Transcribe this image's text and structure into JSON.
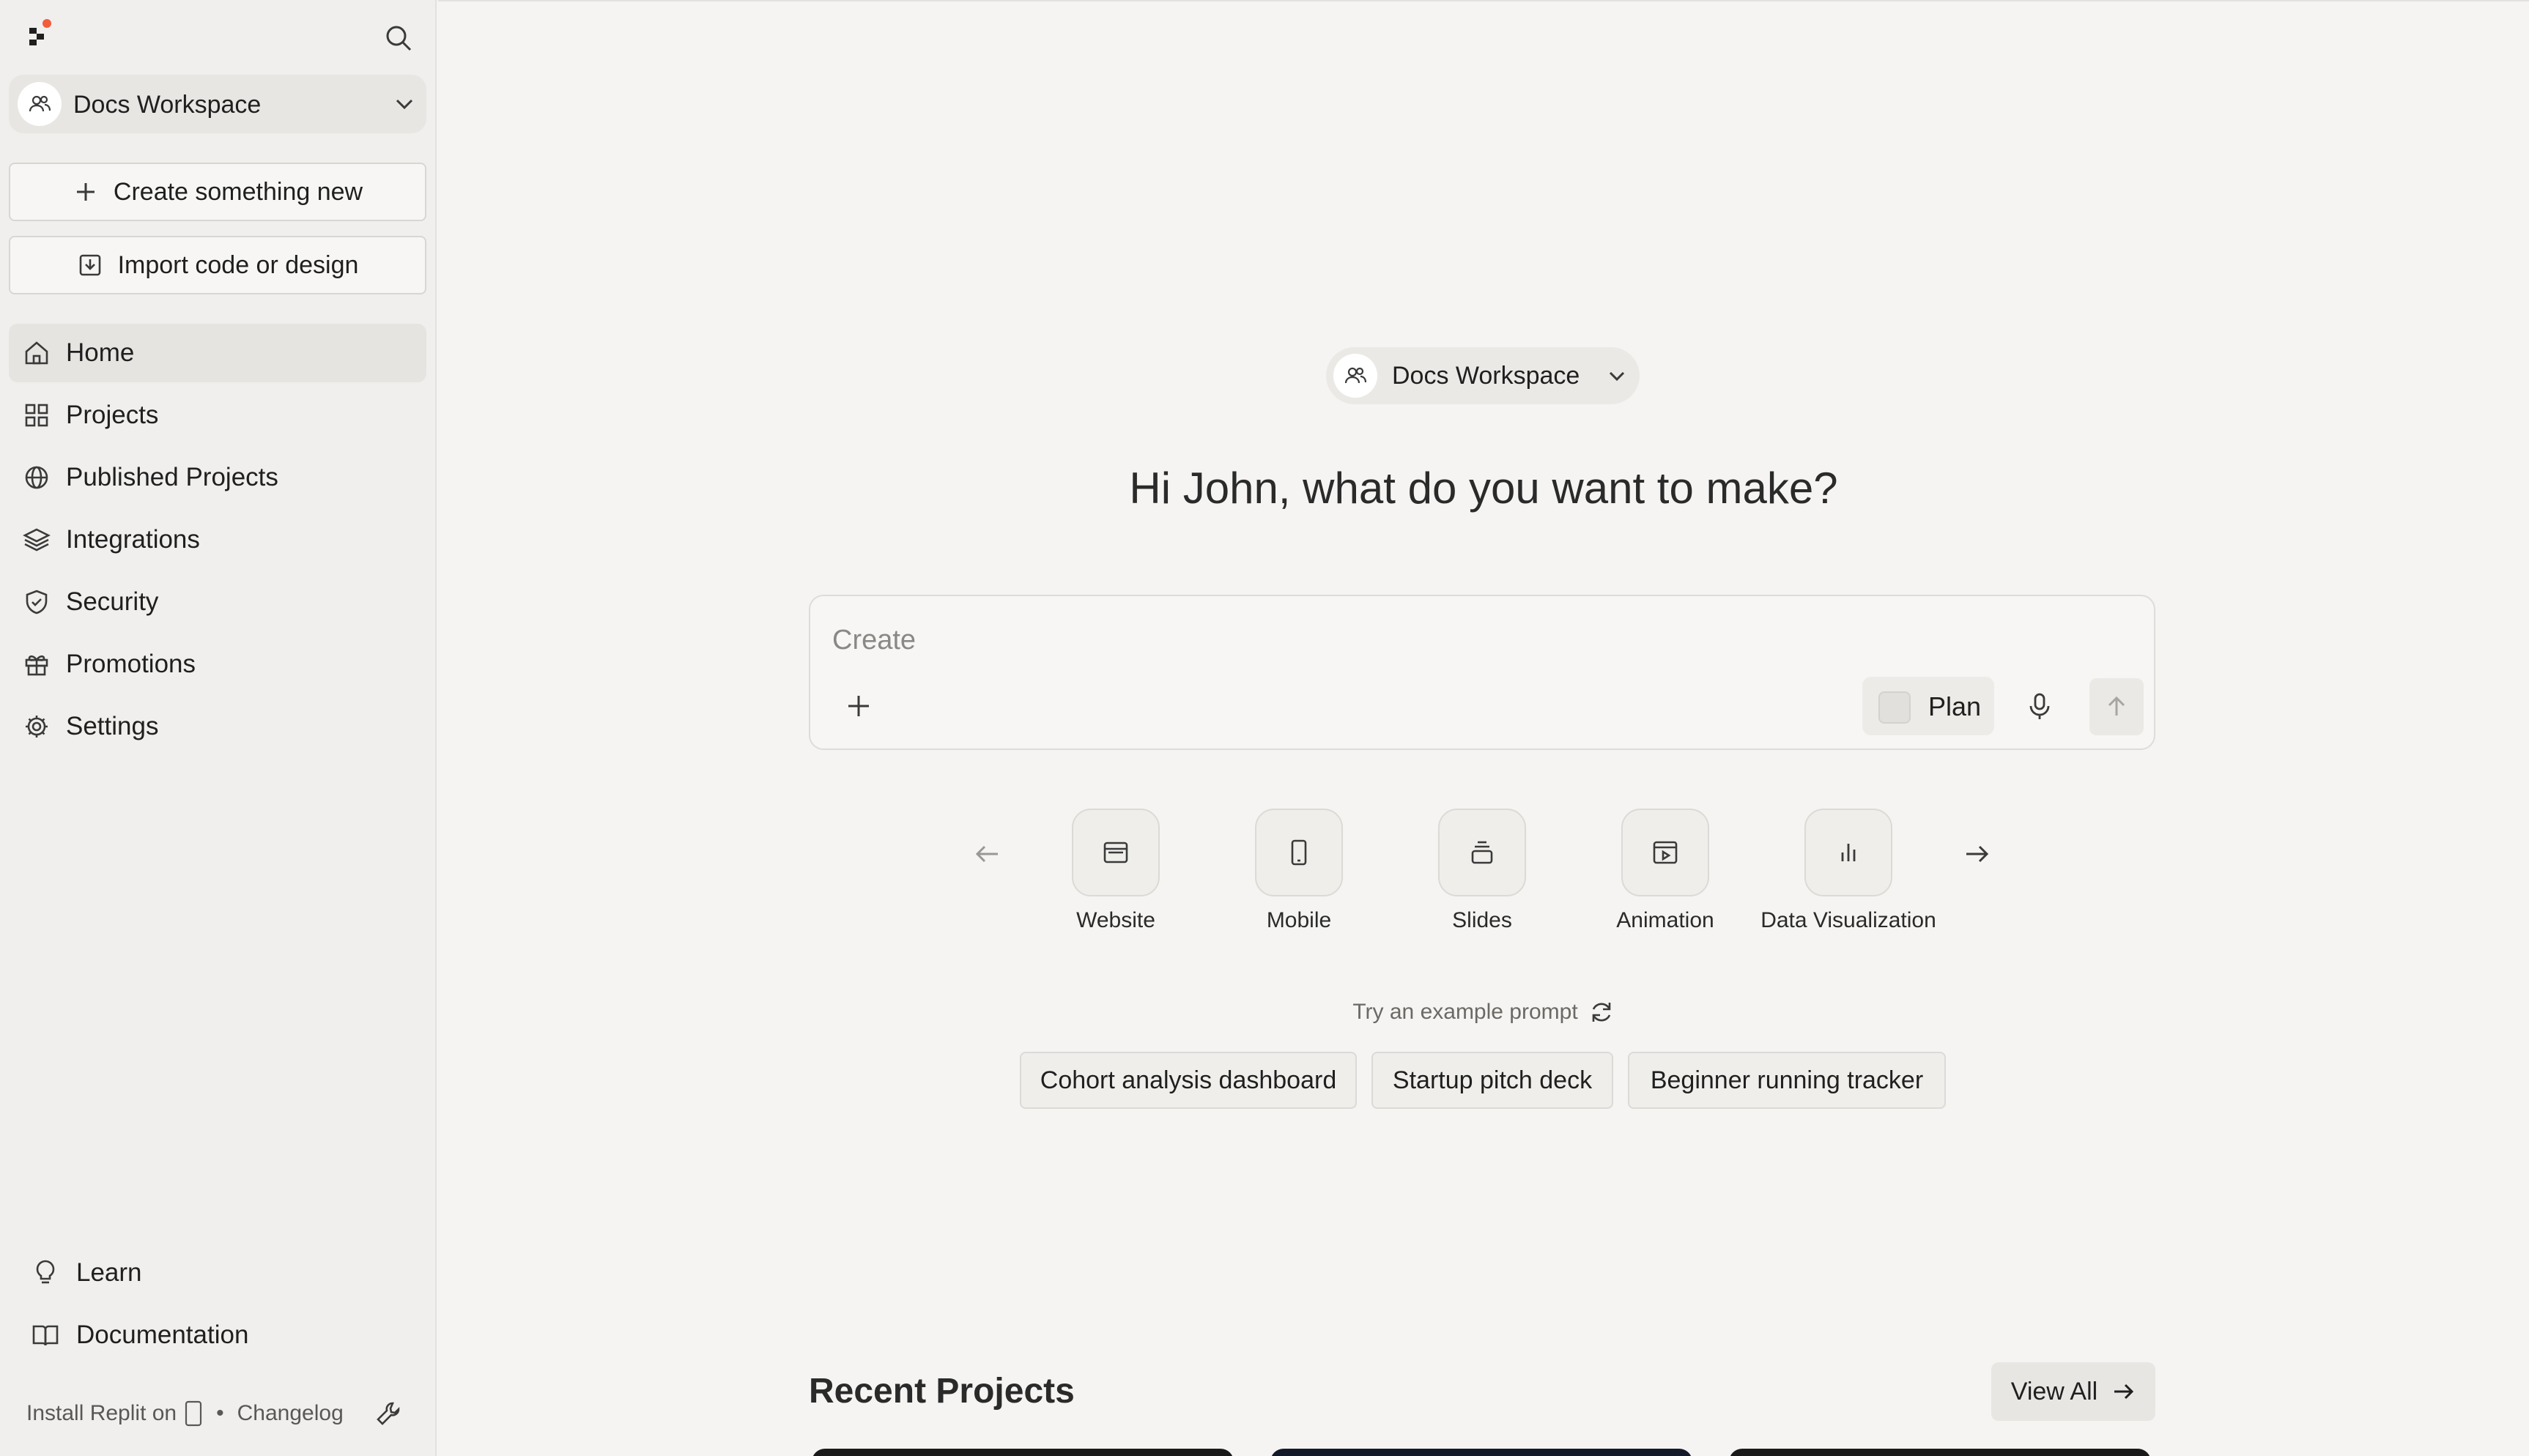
{
  "sidebar": {
    "workspace": "Docs Workspace",
    "create_label": "Create something new",
    "import_label": "Import code or design",
    "nav": [
      {
        "label": "Home",
        "icon": "home-icon"
      },
      {
        "label": "Projects",
        "icon": "grid-icon"
      },
      {
        "label": "Published Projects",
        "icon": "globe-icon"
      },
      {
        "label": "Integrations",
        "icon": "layers-icon"
      },
      {
        "label": "Security",
        "icon": "shield-icon"
      },
      {
        "label": "Promotions",
        "icon": "gift-icon"
      },
      {
        "label": "Settings",
        "icon": "gear-icon"
      }
    ],
    "learn_label": "Learn",
    "docs_label": "Documentation",
    "install_label": "Install Replit on",
    "separator": "•",
    "changelog_label": "Changelog"
  },
  "main": {
    "workspace": "Docs Workspace",
    "headline": "Hi John, what do you want to make?",
    "prompt_placeholder": "Create",
    "plan_label": "Plan",
    "categories": [
      "Website",
      "Mobile",
      "Slides",
      "Animation",
      "Data Visualization"
    ],
    "try_label": "Try an example prompt",
    "examples": [
      "Cohort analysis dashboard",
      "Startup pitch deck",
      "Beginner running tracker"
    ],
    "recent_title": "Recent Projects",
    "view_all_label": "View All"
  },
  "colors": {
    "sidebar_bg": "#f0efed",
    "main_bg": "#f5f4f2",
    "accent_red": "#f25c3b"
  }
}
